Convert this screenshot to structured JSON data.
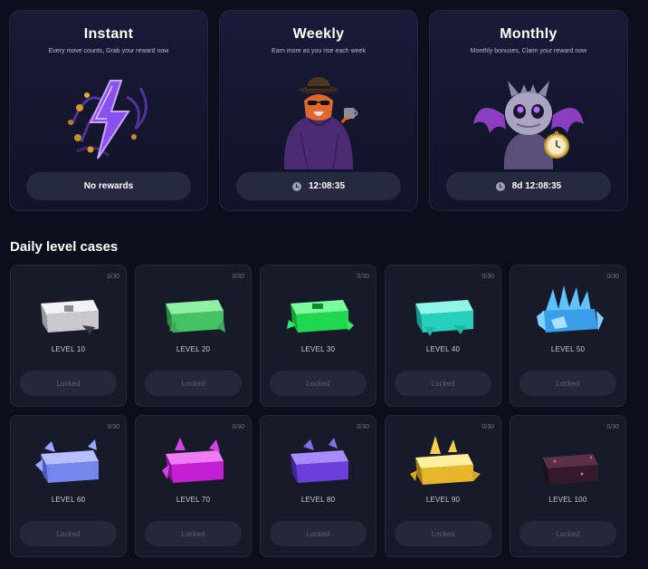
{
  "rewards": {
    "instant": {
      "title": "Instant",
      "subtitle": "Every move counts, Grab your reward now",
      "status": "No rewards",
      "icon": "lightning-bolt-icon"
    },
    "weekly": {
      "title": "Weekly",
      "subtitle": "Earn more as you rise each week",
      "status": "12:08:35",
      "icon": "clock-icon"
    },
    "monthly": {
      "title": "Monthly",
      "subtitle": "Monthly bonuses, Claim your reward now",
      "status": "8d 12:08:35",
      "icon": "clock-icon"
    }
  },
  "daily": {
    "title": "Daily level cases",
    "cases": [
      {
        "name": "LEVEL 10",
        "progress": "0/30",
        "button": "Locked",
        "color": "#d9d9dc"
      },
      {
        "name": "LEVEL 20",
        "progress": "0/30",
        "button": "Locked",
        "color": "#59d47a"
      },
      {
        "name": "LEVEL 30",
        "progress": "0/30",
        "button": "Locked",
        "color": "#27e85c"
      },
      {
        "name": "LEVEL 40",
        "progress": "0/30",
        "button": "Locked",
        "color": "#33e0c8"
      },
      {
        "name": "LEVEL 50",
        "progress": "0/30",
        "button": "Locked",
        "color": "#4db4f2"
      },
      {
        "name": "LEVEL 60",
        "progress": "0/30",
        "button": "Locked",
        "color": "#7f8ff2"
      },
      {
        "name": "LEVEL 70",
        "progress": "0/30",
        "button": "Locked",
        "color": "#d42ee0"
      },
      {
        "name": "LEVEL 80",
        "progress": "0/30",
        "button": "Locked",
        "color": "#7a52e6"
      },
      {
        "name": "LEVEL 90",
        "progress": "0/30",
        "button": "Locked",
        "color": "#f0c63a"
      },
      {
        "name": "LEVEL 100",
        "progress": "0/30",
        "button": "Locked",
        "color": "#4a2738"
      }
    ]
  }
}
